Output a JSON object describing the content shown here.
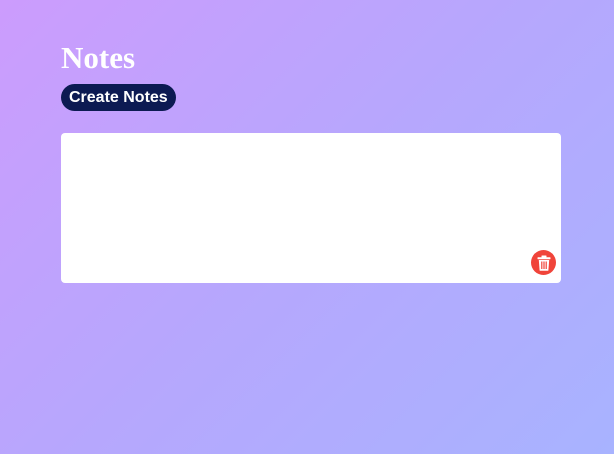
{
  "page": {
    "title": "Notes"
  },
  "toolbar": {
    "create_label": "Create Notes"
  },
  "notes": [
    {
      "text": ""
    }
  ],
  "colors": {
    "button_bg": "#0c1a52",
    "delete_bg": "#f0443a",
    "gradient_start": "#cc9cfd",
    "gradient_end": "#a8b3ff"
  },
  "icons": {
    "delete": "trash-icon"
  }
}
